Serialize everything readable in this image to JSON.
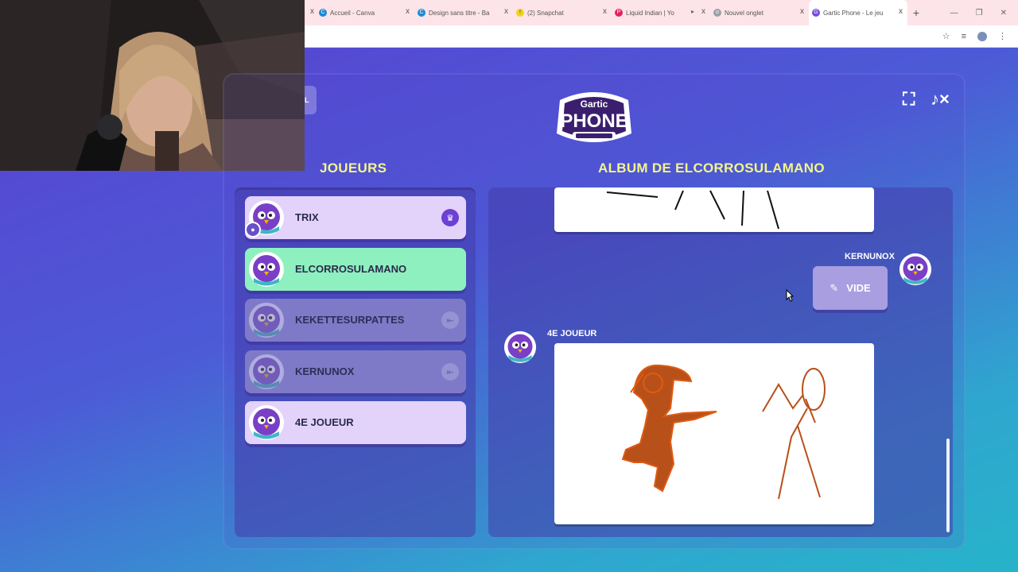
{
  "browser": {
    "tabs": [
      {
        "title": "Accueil - Canva",
        "color": "#1a8ad6",
        "icon": "C"
      },
      {
        "title": "Design sans titre - Ba",
        "color": "#1a8ad6",
        "icon": "C"
      },
      {
        "title": "(2) Snapchat",
        "color": "#f2d21b",
        "icon": "!"
      },
      {
        "title": "Liquid Indian | Yo",
        "color": "#e0245e",
        "icon": "P"
      },
      {
        "title": "Nouvel onglet",
        "color": "#9aa0a6",
        "icon": "o"
      },
      {
        "title": "Gartic Phone - Le jeu",
        "color": "#7a4bd8",
        "icon": "G"
      }
    ],
    "new_tab_label": "+",
    "close_glyph": "x"
  },
  "game": {
    "logo_top": "Gartic",
    "logo_main": "PHONE",
    "players_title": "JOUEURS",
    "album_title": "ALBUM DE ELCORROSULAMANO",
    "back_label": "L"
  },
  "players": [
    {
      "name": "TRIX",
      "state": "owner"
    },
    {
      "name": "ELCORROSULAMANO",
      "state": "highlight"
    },
    {
      "name": "KEKETTESURPATTES",
      "state": "left"
    },
    {
      "name": "KERNUNOX",
      "state": "left"
    },
    {
      "name": "4E JOUEUR",
      "state": "normal"
    }
  ],
  "album": {
    "entries": [
      {
        "author": "KERNUNOX",
        "content": "VIDE"
      },
      {
        "author": "4E JOUEUR",
        "content": "drawing"
      }
    ]
  },
  "colors": {
    "title_yellow": "#f4f58a",
    "highlight_green": "#8ef0bf",
    "card_lavender": "#e3d3fb",
    "crown_purple": "#6c3fd6",
    "drawing_brown": "#b8501a"
  }
}
